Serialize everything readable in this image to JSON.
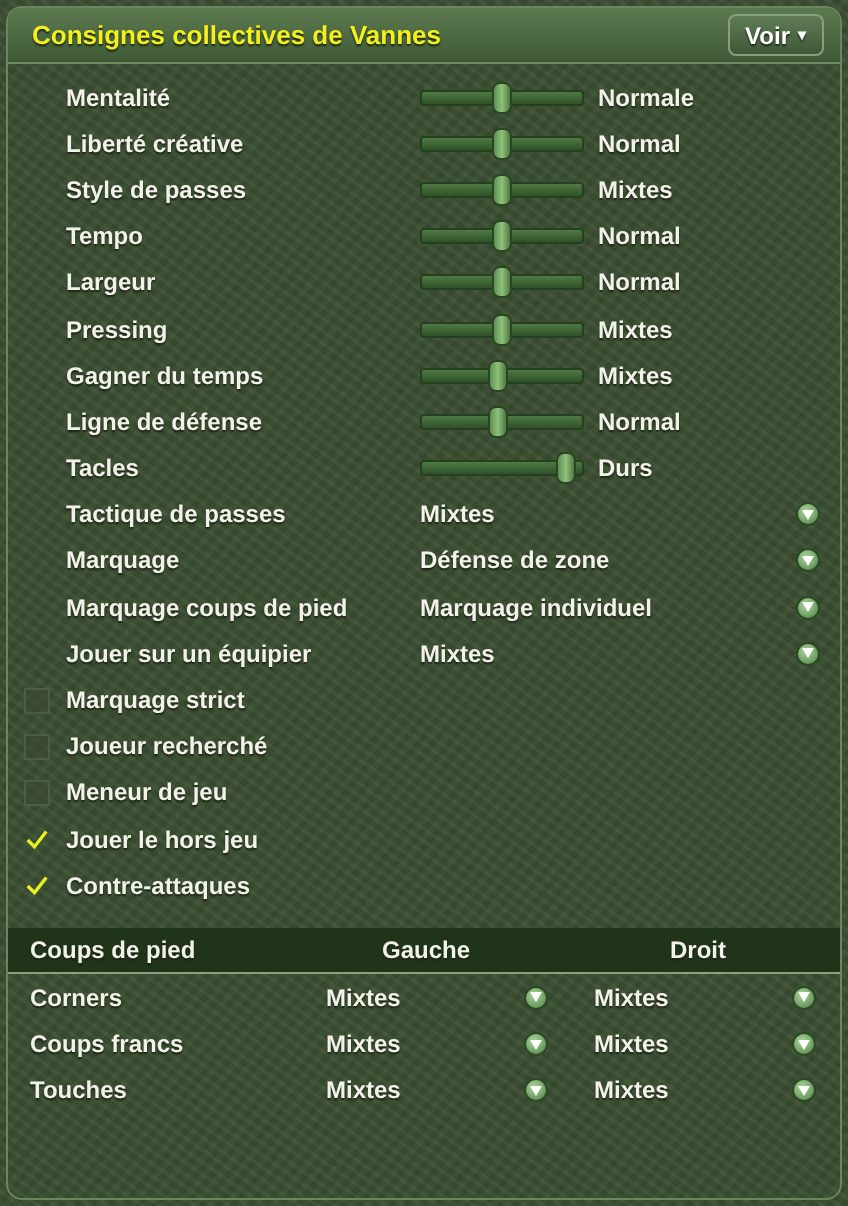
{
  "title": "Consignes collectives de Vannes",
  "view_button": "Voir",
  "view_caret": "▾",
  "settings": [
    {
      "kind": "slider",
      "label": "Mentalité",
      "level": 0.5,
      "value": "Normale"
    },
    {
      "kind": "slider",
      "label": "Liberté créative",
      "level": 0.5,
      "value": "Normal"
    },
    {
      "kind": "slider",
      "label": "Style de passes",
      "level": 0.5,
      "value": "Mixtes"
    },
    {
      "kind": "slider",
      "label": "Tempo",
      "level": 0.5,
      "value": "Normal"
    },
    {
      "kind": "slider",
      "label": "Largeur",
      "level": 0.5,
      "value": "Normal"
    },
    {
      "kind": "slider",
      "label": "Pressing",
      "level": 0.5,
      "value": "Mixtes"
    },
    {
      "kind": "slider",
      "label": "Gagner du temps",
      "level": 0.47,
      "value": "Mixtes"
    },
    {
      "kind": "slider",
      "label": "Ligne de défense",
      "level": 0.47,
      "value": "Normal"
    },
    {
      "kind": "slider",
      "label": "Tacles",
      "level": 0.95,
      "value": "Durs"
    },
    {
      "kind": "dropdown",
      "label": "Tactique de passes",
      "value": "Mixtes"
    },
    {
      "kind": "dropdown",
      "label": "Marquage",
      "value": "Défense de zone"
    },
    {
      "kind": "dropdown",
      "label": "Marquage coups de pied",
      "value": "Marquage individuel"
    },
    {
      "kind": "dropdown",
      "label": "Jouer sur un équipier",
      "value": "Mixtes"
    },
    {
      "kind": "checkbox",
      "label": "Marquage strict",
      "checked": false
    },
    {
      "kind": "checkbox",
      "label": "Joueur recherché",
      "checked": false
    },
    {
      "kind": "checkbox",
      "label": "Meneur de jeu",
      "checked": false
    },
    {
      "kind": "checkbox",
      "label": "Jouer le hors jeu",
      "checked": true
    },
    {
      "kind": "checkbox",
      "label": "Contre-attaques",
      "checked": true
    }
  ],
  "set_pieces": {
    "columns": [
      "Coups de pied",
      "Gauche",
      "Droit"
    ],
    "rows": [
      {
        "name": "Corners",
        "left": "Mixtes",
        "right": "Mixtes"
      },
      {
        "name": "Coups francs",
        "left": "Mixtes",
        "right": "Mixtes"
      },
      {
        "name": "Touches",
        "left": "Mixtes",
        "right": "Mixtes"
      }
    ]
  }
}
